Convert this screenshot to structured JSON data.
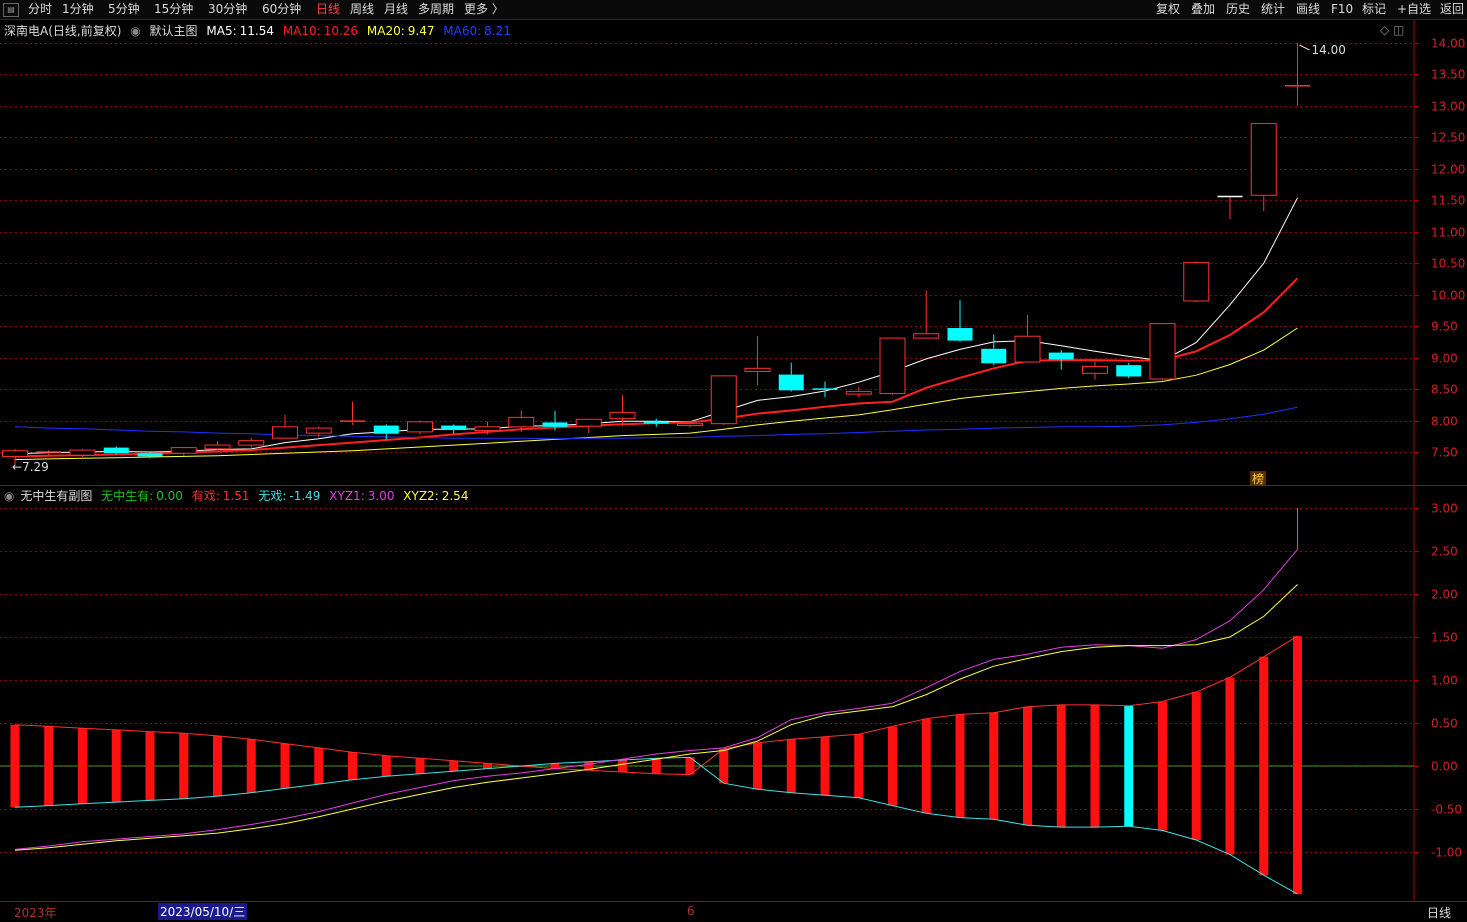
{
  "toolbar": {
    "periods": [
      "分时",
      "1分钟",
      "5分钟",
      "15分钟",
      "30分钟",
      "60分钟",
      "日线",
      "周线",
      "月线",
      "多周期",
      "更多 〉"
    ],
    "active_period": "日线",
    "tools": [
      "复权",
      "叠加",
      "历史",
      "统计",
      "画线",
      "F10",
      "标记",
      "+自选",
      "返回"
    ]
  },
  "main_panel": {
    "stock_title": "深南电A(日线,前复权)",
    "chart_name": "默认主图",
    "ma5": {
      "label": "MA5:",
      "value": "11.54",
      "color": "#ffffff"
    },
    "ma10": {
      "label": "MA10:",
      "value": "10.26",
      "color": "#ff2020"
    },
    "ma20": {
      "label": "MA20:",
      "value": "9.47",
      "color": "#ffff40"
    },
    "ma60": {
      "label": "MA60:",
      "value": "8.21",
      "color": "#2030ff"
    },
    "high_label": "14.00",
    "low_label": "7.29",
    "marker": "榜"
  },
  "sub_panel": {
    "chart_name": "无中生有副图",
    "wzsy": {
      "label": "无中生有:",
      "value": "0.00",
      "color": "#20c020"
    },
    "youxi": {
      "label": "有戏:",
      "value": "1.51",
      "color": "#ff3030"
    },
    "wuxi": {
      "label": "无戏:",
      "value": "-1.49",
      "color": "#40e0e0"
    },
    "xyz1": {
      "label": "XYZ1:",
      "value": "3.00",
      "color": "#e040e0"
    },
    "xyz2": {
      "label": "XYZ2:",
      "value": "2.54",
      "color": "#ffff40"
    }
  },
  "bottom_bar": {
    "year_label": "2023年",
    "cursor_date": "2023/05/10/三",
    "month_label": "6",
    "period_label": "日线"
  },
  "colors": {
    "up": "#ff3030",
    "down": "#00ffff",
    "grid": "#8b0000",
    "axis": "#b00000"
  },
  "chart_data": [
    {
      "type": "candlestick",
      "title": "深南电A(日线,前复权)",
      "y_ticks": [
        7.5,
        8.0,
        8.5,
        9.0,
        9.5,
        10.0,
        10.5,
        11.0,
        11.5,
        12.0,
        12.5,
        13.0,
        13.5,
        14.0
      ],
      "ylim": [
        7.05,
        14.1
      ],
      "candles": [
        {
          "o": 7.43,
          "c": 7.52,
          "h": 7.55,
          "l": 7.29
        },
        {
          "o": 7.48,
          "c": 7.5,
          "h": 7.53,
          "l": 7.44
        },
        {
          "o": 7.45,
          "c": 7.53,
          "h": 7.55,
          "l": 7.42
        },
        {
          "o": 7.57,
          "c": 7.48,
          "h": 7.59,
          "l": 7.46
        },
        {
          "o": 7.48,
          "c": 7.43,
          "h": 7.5,
          "l": 7.4
        },
        {
          "o": 7.48,
          "c": 7.57,
          "h": 7.58,
          "l": 7.44
        },
        {
          "o": 7.55,
          "c": 7.61,
          "h": 7.67,
          "l": 7.53
        },
        {
          "o": 7.61,
          "c": 7.68,
          "h": 7.72,
          "l": 7.57
        },
        {
          "o": 7.72,
          "c": 7.9,
          "h": 8.09,
          "l": 7.7
        },
        {
          "o": 7.8,
          "c": 7.88,
          "h": 7.91,
          "l": 7.75
        },
        {
          "o": 7.97,
          "c": 7.99,
          "h": 8.3,
          "l": 7.93
        },
        {
          "o": 7.92,
          "c": 7.79,
          "h": 7.94,
          "l": 7.7
        },
        {
          "o": 7.82,
          "c": 7.98,
          "h": 8.0,
          "l": 7.78
        },
        {
          "o": 7.92,
          "c": 7.85,
          "h": 7.94,
          "l": 7.79
        },
        {
          "o": 7.84,
          "c": 7.9,
          "h": 7.98,
          "l": 7.78
        },
        {
          "o": 7.9,
          "c": 8.05,
          "h": 8.16,
          "l": 7.82
        },
        {
          "o": 7.97,
          "c": 7.9,
          "h": 8.15,
          "l": 7.84
        },
        {
          "o": 7.91,
          "c": 8.02,
          "h": 8.03,
          "l": 7.8
        },
        {
          "o": 8.03,
          "c": 8.13,
          "h": 8.4,
          "l": 7.91
        },
        {
          "o": 7.98,
          "c": 7.95,
          "h": 8.03,
          "l": 7.9
        },
        {
          "o": 7.92,
          "c": 7.95,
          "h": 7.99,
          "l": 7.89
        },
        {
          "o": 7.95,
          "c": 8.71,
          "h": 8.72,
          "l": 7.93
        },
        {
          "o": 8.78,
          "c": 8.83,
          "h": 9.34,
          "l": 8.56
        },
        {
          "o": 8.73,
          "c": 8.48,
          "h": 8.92,
          "l": 8.46
        },
        {
          "o": 8.5,
          "c": 8.48,
          "h": 8.62,
          "l": 8.37
        },
        {
          "o": 8.42,
          "c": 8.46,
          "h": 8.54,
          "l": 8.37
        },
        {
          "o": 8.43,
          "c": 9.31,
          "h": 9.32,
          "l": 8.41
        },
        {
          "o": 9.31,
          "c": 9.38,
          "h": 10.07,
          "l": 9.3
        },
        {
          "o": 9.47,
          "c": 9.27,
          "h": 9.91,
          "l": 9.25
        },
        {
          "o": 9.14,
          "c": 8.91,
          "h": 9.37,
          "l": 8.88
        },
        {
          "o": 8.93,
          "c": 9.34,
          "h": 9.68,
          "l": 8.92
        },
        {
          "o": 9.08,
          "c": 8.97,
          "h": 9.12,
          "l": 8.81
        },
        {
          "o": 8.75,
          "c": 8.86,
          "h": 8.95,
          "l": 8.65
        },
        {
          "o": 8.88,
          "c": 8.7,
          "h": 8.92,
          "l": 8.67
        },
        {
          "o": 8.66,
          "c": 9.54,
          "h": 9.55,
          "l": 8.64
        },
        {
          "o": 9.9,
          "c": 10.51,
          "h": 10.53,
          "l": 9.88
        },
        {
          "o": 11.56,
          "c": 11.56,
          "h": 11.56,
          "l": 11.2
        },
        {
          "o": 11.58,
          "c": 12.72,
          "h": 12.73,
          "l": 11.33
        },
        {
          "o": 13.32,
          "c": 13.32,
          "h": 14.0,
          "l": 13.0
        }
      ],
      "series": [
        {
          "name": "MA5",
          "values": [
            7.47,
            7.49,
            7.5,
            7.51,
            7.5,
            7.51,
            7.54,
            7.55,
            7.65,
            7.71,
            7.79,
            7.82,
            7.86,
            7.86,
            7.87,
            7.91,
            7.92,
            7.95,
            7.99,
            7.99,
            7.98,
            8.15,
            8.32,
            8.38,
            8.47,
            8.61,
            8.78,
            8.98,
            9.13,
            9.25,
            9.27,
            9.19,
            9.1,
            9.02,
            8.95,
            9.24,
            9.84,
            10.5,
            11.54
          ]
        },
        {
          "name": "MA10",
          "values": [
            7.43,
            7.44,
            7.45,
            7.46,
            7.47,
            7.49,
            7.51,
            7.53,
            7.57,
            7.61,
            7.65,
            7.69,
            7.73,
            7.78,
            7.82,
            7.86,
            7.89,
            7.92,
            7.94,
            7.96,
            7.97,
            8.03,
            8.11,
            8.16,
            8.22,
            8.27,
            8.3,
            8.52,
            8.68,
            8.83,
            8.95,
            8.96,
            8.96,
            8.95,
            8.96,
            9.1,
            9.36,
            9.72,
            10.26
          ]
        },
        {
          "name": "MA20",
          "values": [
            7.38,
            7.39,
            7.4,
            7.41,
            7.42,
            7.43,
            7.44,
            7.46,
            7.48,
            7.5,
            7.52,
            7.55,
            7.58,
            7.61,
            7.64,
            7.67,
            7.7,
            7.73,
            7.76,
            7.78,
            7.8,
            7.86,
            7.93,
            7.99,
            8.04,
            8.09,
            8.17,
            8.26,
            8.35,
            8.41,
            8.46,
            8.51,
            8.55,
            8.58,
            8.62,
            8.72,
            8.89,
            9.12,
            9.47
          ]
        },
        {
          "name": "MA60",
          "values": [
            7.9,
            7.88,
            7.87,
            7.85,
            7.83,
            7.82,
            7.8,
            7.79,
            7.77,
            7.76,
            7.75,
            7.74,
            7.73,
            7.72,
            7.72,
            7.72,
            7.71,
            7.72,
            7.72,
            7.73,
            7.73,
            7.75,
            7.76,
            7.78,
            7.79,
            7.81,
            7.83,
            7.85,
            7.86,
            7.88,
            7.89,
            7.9,
            7.9,
            7.91,
            7.93,
            7.97,
            8.03,
            8.1,
            8.21
          ]
        }
      ]
    },
    {
      "type": "bar",
      "title": "无中生有副图",
      "y_ticks": [
        -1.0,
        -0.5,
        0.0,
        0.5,
        1.0,
        1.5,
        2.0,
        2.5,
        3.0
      ],
      "ylim": [
        -1.49,
        3.1
      ],
      "series": [
        {
          "name": "有戏",
          "values": [
            0.48,
            0.46,
            0.44,
            0.42,
            0.4,
            0.38,
            0.35,
            0.31,
            0.26,
            0.21,
            0.16,
            0.12,
            0.09,
            0.06,
            0.03,
            0.0,
            -0.03,
            -0.05,
            -0.07,
            -0.09,
            -0.1,
            0.2,
            0.27,
            0.31,
            0.34,
            0.37,
            0.46,
            0.55,
            0.6,
            0.62,
            0.69,
            0.71,
            0.71,
            0.7,
            0.75,
            0.86,
            1.03,
            1.27,
            1.51
          ]
        },
        {
          "name": "无戏",
          "values": [
            -0.48,
            -0.46,
            -0.44,
            -0.42,
            -0.4,
            -0.38,
            -0.35,
            -0.31,
            -0.26,
            -0.21,
            -0.16,
            -0.12,
            -0.09,
            -0.06,
            -0.03,
            0.0,
            0.03,
            0.05,
            0.07,
            0.09,
            0.1,
            -0.2,
            -0.27,
            -0.31,
            -0.34,
            -0.37,
            -0.46,
            -0.55,
            -0.6,
            -0.62,
            -0.69,
            -0.71,
            -0.71,
            -0.7,
            -0.75,
            -0.86,
            -1.03,
            -1.27,
            -1.49
          ]
        },
        {
          "name": "XYZ1",
          "values": [
            -0.97,
            -0.93,
            -0.88,
            -0.85,
            -0.82,
            -0.79,
            -0.74,
            -0.68,
            -0.61,
            -0.53,
            -0.43,
            -0.33,
            -0.25,
            -0.17,
            -0.12,
            -0.08,
            -0.03,
            0.02,
            0.08,
            0.14,
            0.18,
            0.21,
            0.33,
            0.54,
            0.62,
            0.67,
            0.73,
            0.91,
            1.1,
            1.24,
            1.3,
            1.38,
            1.41,
            1.4,
            1.37,
            1.47,
            1.69,
            2.05,
            2.52,
            3.0
          ]
        },
        {
          "name": "XYZ2",
          "values": [
            -0.98,
            -0.95,
            -0.91,
            -0.87,
            -0.84,
            -0.81,
            -0.78,
            -0.73,
            -0.67,
            -0.59,
            -0.5,
            -0.41,
            -0.33,
            -0.25,
            -0.19,
            -0.14,
            -0.09,
            -0.04,
            0.02,
            0.08,
            0.14,
            0.18,
            0.29,
            0.48,
            0.59,
            0.64,
            0.69,
            0.83,
            1.01,
            1.16,
            1.25,
            1.33,
            1.38,
            1.4,
            1.4,
            1.41,
            1.5,
            1.74,
            2.11,
            2.54
          ]
        }
      ]
    }
  ]
}
